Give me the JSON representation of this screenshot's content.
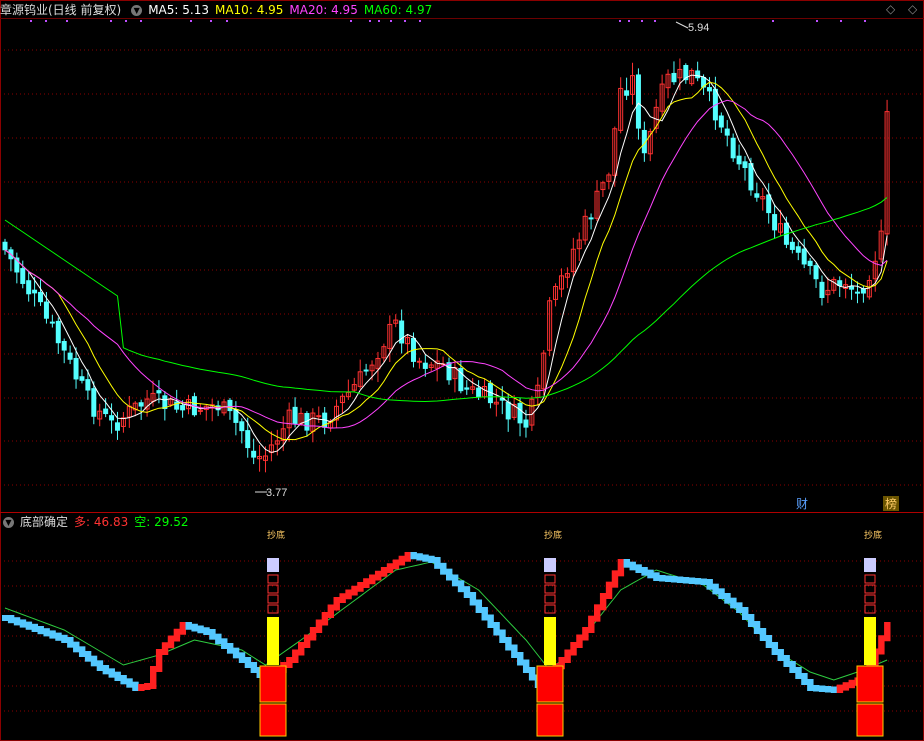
{
  "stock": {
    "title": "章源钨业(日线 前复权)",
    "ma_lines": [
      {
        "label": "MA5:",
        "value": "5.13",
        "color": "#ffffff"
      },
      {
        "label": "MA10:",
        "value": "4.95",
        "color": "#ffff00"
      },
      {
        "label": "MA20:",
        "value": "4.95",
        "color": "#ff44ff"
      },
      {
        "label": "MA60:",
        "value": "4.97",
        "color": "#00ff00"
      }
    ],
    "high_label": "5.94",
    "low_label": "3.77",
    "markers": {
      "cai": "财",
      "bang": "榜"
    }
  },
  "indicator": {
    "title": "底部确定",
    "duo_label": "多:",
    "duo_value": "46.83",
    "kong_label": "空:",
    "kong_value": "29.52",
    "signal_label": "抄底"
  },
  "colors": {
    "up": "#ff3232",
    "down": "#54ffff",
    "ma5": "#ffffff",
    "ma10": "#ffff00",
    "ma20": "#ff44ff",
    "ma60": "#00ff00",
    "duo_line": "#ff2020",
    "kong_line": "#54c8ff",
    "grid": "#8b0000"
  },
  "icons": {
    "collapse": "chevron-down-icon",
    "scroll": "diamond-icon"
  }
}
